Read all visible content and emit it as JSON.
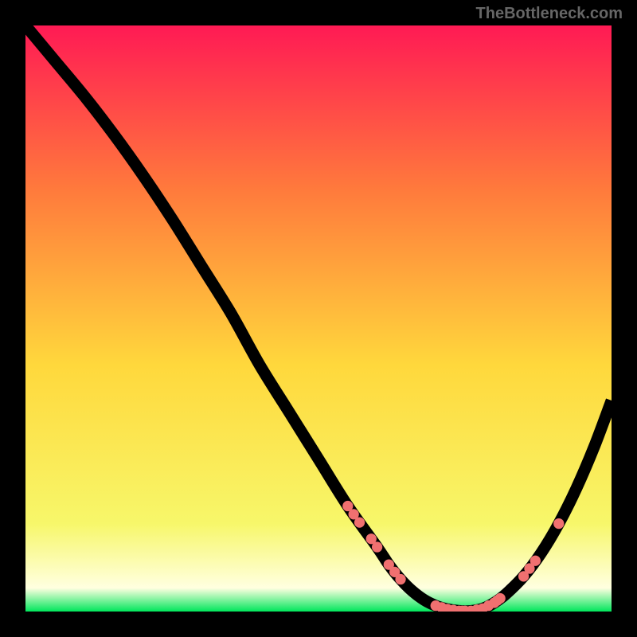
{
  "watermark": "TheBottleneck.com",
  "colors": {
    "bg_outer": "#000000",
    "grad_top": "#ff1a54",
    "grad_mid_upper": "#ff7a3c",
    "grad_mid": "#ffd83c",
    "grad_lower": "#f7f76a",
    "grad_bottom_light": "#ffffe0",
    "grad_bottom": "#00e65c",
    "curve": "#000000",
    "marker": "#f07070"
  },
  "chart_data": {
    "type": "line",
    "title": "",
    "xlabel": "",
    "ylabel": "",
    "xlim": [
      0,
      100
    ],
    "ylim": [
      0,
      100
    ],
    "series": [
      {
        "name": "curve",
        "x": [
          0,
          5,
          10,
          15,
          20,
          25,
          30,
          35,
          40,
          45,
          50,
          55,
          60,
          62,
          64,
          66,
          68,
          70,
          72,
          74,
          76,
          78,
          80,
          82,
          85,
          88,
          91,
          94,
          97,
          100
        ],
        "y": [
          100,
          94,
          88,
          81.5,
          74.5,
          67,
          59,
          51,
          42,
          34,
          26,
          18,
          11,
          8,
          5.5,
          3.5,
          2,
          1,
          0.4,
          0.1,
          0.1,
          0.5,
          1.5,
          3,
          6,
          10,
          15,
          21,
          28,
          36
        ]
      }
    ],
    "markers_on_curve_x": [
      55,
      56,
      57,
      59,
      60,
      62,
      63,
      64,
      70,
      71,
      72,
      73,
      74,
      74.5,
      75,
      76,
      77,
      78,
      79,
      80,
      80.5,
      81,
      85,
      86,
      87,
      91
    ]
  }
}
